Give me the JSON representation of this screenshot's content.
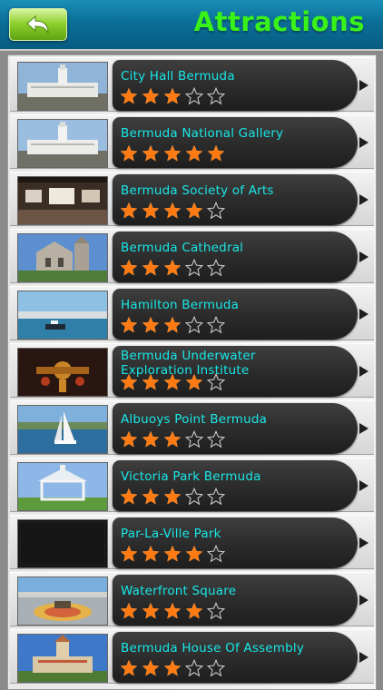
{
  "header": {
    "title": "Attractions",
    "back_icon": "back-arrow-icon"
  },
  "colors": {
    "header_bg": "#0b6f98",
    "title": "#39f21a",
    "name_text": "#19e7e7",
    "star_filled": "#ff7a12",
    "star_empty": "#cccccc"
  },
  "attractions": [
    {
      "name": "City Hall Bermuda",
      "rating": 3,
      "max_rating": 5
    },
    {
      "name": "Bermuda National Gallery",
      "rating": 5,
      "max_rating": 5
    },
    {
      "name": "Bermuda Society of Arts",
      "rating": 4,
      "max_rating": 5
    },
    {
      "name": "Bermuda Cathedral",
      "rating": 3,
      "max_rating": 5
    },
    {
      "name": "Hamilton Bermuda",
      "rating": 3,
      "max_rating": 5
    },
    {
      "name": "Bermuda Underwater Exploration Institute",
      "rating": 4,
      "max_rating": 5
    },
    {
      "name": "Albuoys Point Bermuda",
      "rating": 3,
      "max_rating": 5
    },
    {
      "name": "Victoria Park Bermuda",
      "rating": 3,
      "max_rating": 5
    },
    {
      "name": "Par-La-Ville Park",
      "rating": 4,
      "max_rating": 5
    },
    {
      "name": "Waterfront Square",
      "rating": 4,
      "max_rating": 5
    },
    {
      "name": "Bermuda House Of Assembly",
      "rating": 3,
      "max_rating": 5
    }
  ]
}
